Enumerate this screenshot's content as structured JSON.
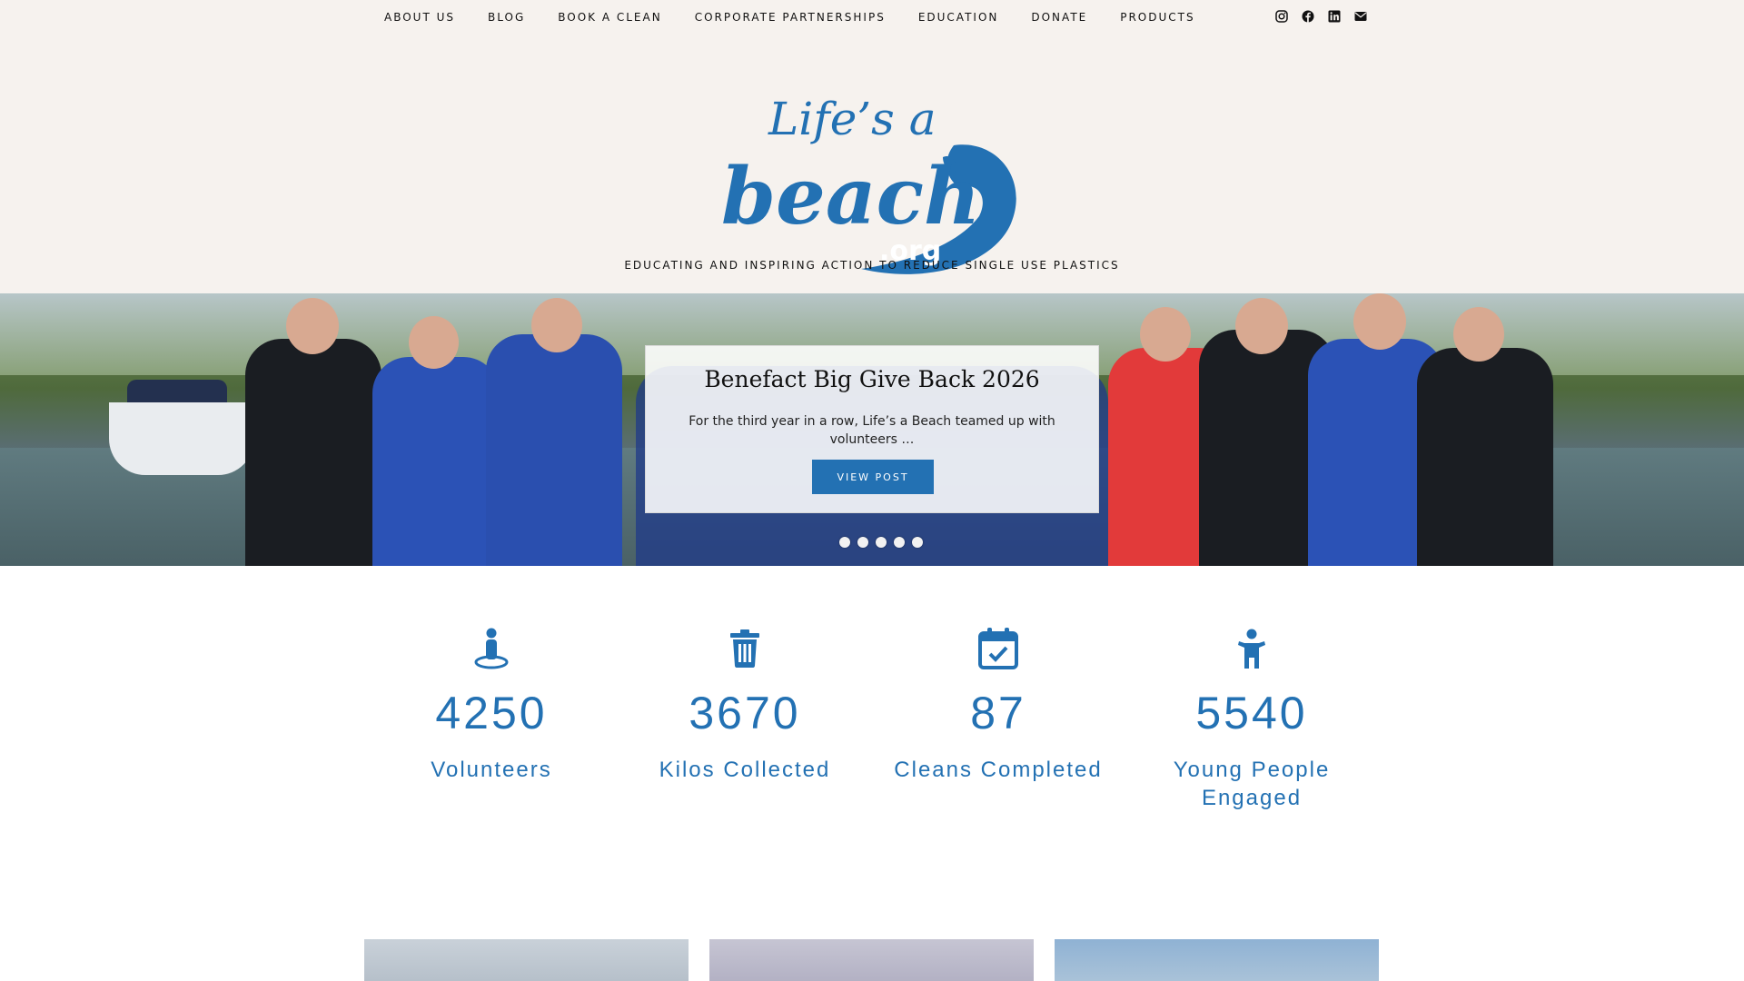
{
  "nav": {
    "items": [
      "ABOUT US",
      "BLOG",
      "BOOK A CLEAN",
      "CORPORATE PARTNERSHIPS",
      "EDUCATION",
      "DONATE",
      "PRODUCTS"
    ],
    "socials": [
      "instagram-icon",
      "facebook-icon",
      "linkedin-icon",
      "email-icon"
    ]
  },
  "header": {
    "logo_text": {
      "line1": "Life's a",
      "line2": "beach",
      "line3": ".org"
    },
    "tagline": "EDUCATING AND INSPIRING ACTION TO REDUCE SINGLE USE PLASTICS"
  },
  "hero": {
    "title": "Benefact Big Give Back 2026",
    "excerpt": "For the third year in a row, Life’s a Beach teamed up with volunteers …",
    "button": "VIEW POST",
    "slides": 5
  },
  "stats": [
    {
      "icon": "person-pin-icon",
      "value": "4250",
      "label": "Volunteers"
    },
    {
      "icon": "trash-icon",
      "value": "3670",
      "label": "Kilos Collected"
    },
    {
      "icon": "calendar-check-icon",
      "value": "87",
      "label": "Cleans Completed"
    },
    {
      "icon": "child-icon",
      "value": "5540",
      "label": "Young People Engaged"
    }
  ],
  "colors": {
    "brand_blue": "#2371b3",
    "header_bg": "#f6f2ee"
  }
}
